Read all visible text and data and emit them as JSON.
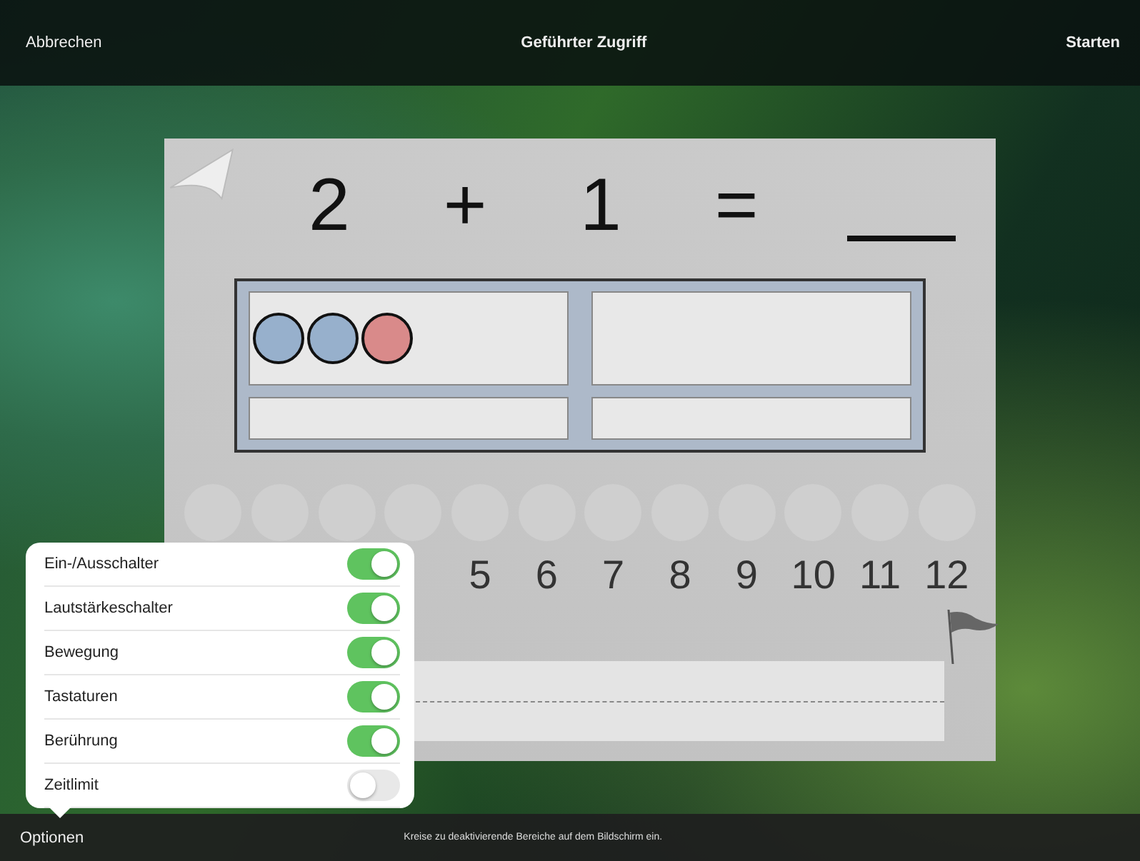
{
  "top_bar": {
    "cancel": "Abbrechen",
    "title": "Geführter Zugriff",
    "start": "Starten"
  },
  "worksheet": {
    "equation": [
      "2",
      "+",
      "1",
      "="
    ],
    "ten_frame": {
      "counters": [
        {
          "color": "#97b0cc"
        },
        {
          "color": "#97b0cc"
        },
        {
          "color": "#d98a8a"
        }
      ]
    },
    "number_line": [
      "5",
      "6",
      "7",
      "8",
      "9",
      "10",
      "11",
      "12"
    ]
  },
  "options_popover": {
    "items": [
      {
        "label": "Ein-/Ausschalter",
        "on": true
      },
      {
        "label": "Lautstärkeschalter",
        "on": true
      },
      {
        "label": "Bewegung",
        "on": true
      },
      {
        "label": "Tastaturen",
        "on": true
      },
      {
        "label": "Berührung",
        "on": true
      },
      {
        "label": "Zeitlimit",
        "on": false
      }
    ]
  },
  "bottom_bar": {
    "options": "Optionen",
    "hint": "Kreise zu deaktivierende Bereiche auf dem Bildschirm ein."
  }
}
